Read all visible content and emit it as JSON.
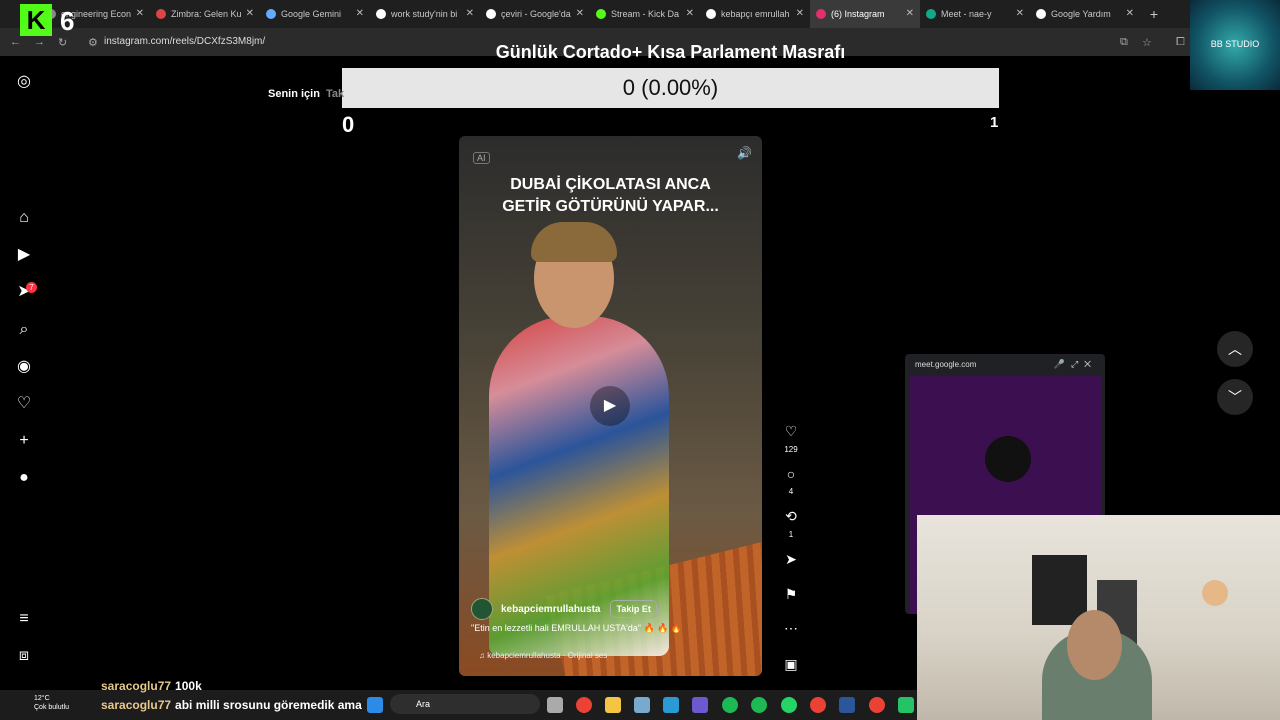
{
  "browser": {
    "tabs": [
      {
        "label": "engineering Econ",
        "active": false
      },
      {
        "label": "Zimbra: Gelen Ku",
        "active": false
      },
      {
        "label": "Google Gemini",
        "active": false
      },
      {
        "label": "work study'nin bi",
        "active": false
      },
      {
        "label": "çeviri - Google'da",
        "active": false
      },
      {
        "label": "Stream - Kick Da",
        "active": false
      },
      {
        "label": "kebapçı emrullah",
        "active": false
      },
      {
        "label": "(6) Instagram",
        "active": true
      },
      {
        "label": "Meet - nae-y",
        "active": false
      },
      {
        "label": "Google Yardım",
        "active": false
      }
    ],
    "url": "instagram.com/reels/DCXfzS3M8jm/"
  },
  "overlay": {
    "kick_logo": "K",
    "kick_count": "6",
    "bb_studio": "BB STUDIO",
    "title": "Günlük Cortado+ Kısa Parlament Masrafı",
    "progress_text": "0 (0.00%)",
    "progress_fraction": 0.0,
    "min_value": "0",
    "max_value": "1"
  },
  "sidebar": {
    "notification_count": "7"
  },
  "feed_tabs": {
    "for_you": "Senin için",
    "following": "Tak"
  },
  "reel": {
    "ai_badge": "AI",
    "caption_line1": "DUBAİ ÇİKOLATASI ANCA",
    "caption_line2": "GETİR GÖTÜRÜNÜ YAPAR...",
    "username": "kebapciemrullahusta",
    "follow_label": "Takip Et",
    "description": "\"Etin en lezzetli hali EMRULLAH USTA'da\" 🔥 🔥 🔥",
    "audio": "kebapciemrullahusta · Orijinal ses",
    "likes": "129",
    "comments": "4",
    "reposts": "1"
  },
  "meet": {
    "domain": "meet.google.com"
  },
  "chat": [
    {
      "user": "saracoglu77",
      "message": "100k"
    },
    {
      "user": "saracoglu77",
      "message": "abi milli srosunu göremedik ama"
    }
  ],
  "taskbar": {
    "temp": "12°C",
    "weather": "Çok bulutlu",
    "search_placeholder": "Ara"
  },
  "colors": {
    "kick_green": "#53fc18",
    "notification_red": "#ff3040",
    "meet_purple": "#3c0f50"
  }
}
